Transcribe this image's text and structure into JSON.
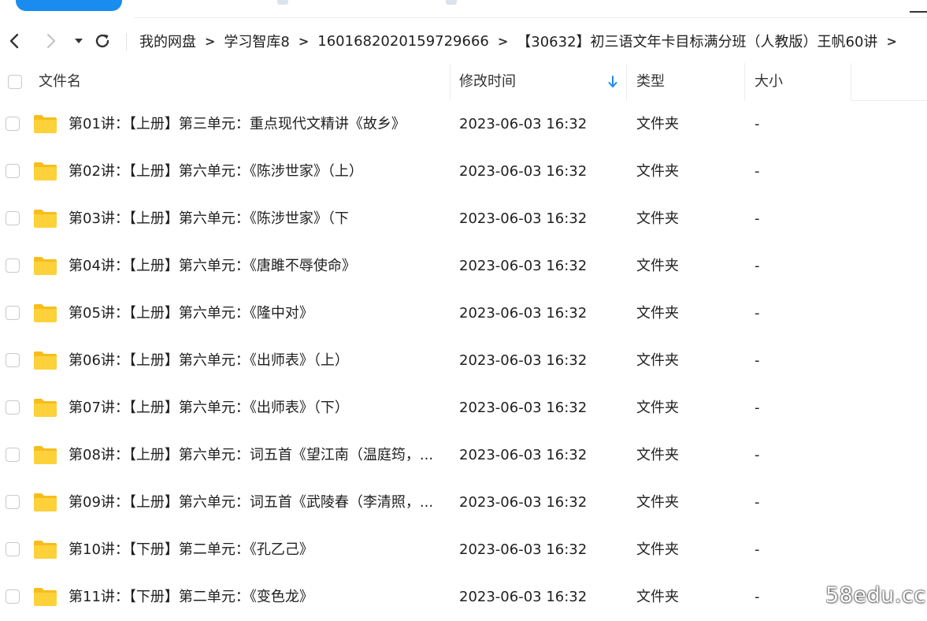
{
  "nav": {
    "back_icon": "arrow-left-icon",
    "forward_icon": "arrow-right-icon",
    "history_icon": "caret-down-icon",
    "refresh_icon": "refresh-icon",
    "separator": ">",
    "breadcrumbs": [
      "我的网盘",
      "学习智库8",
      "1601682020159729666",
      "【30632】初三语文年卡目标满分班（人教版）王帆60讲"
    ]
  },
  "columns": {
    "name": "文件名",
    "modified": "修改时间",
    "type": "类型",
    "size": "大小"
  },
  "colors": {
    "accent": "#1a8cf0",
    "folder": "#fdd13a",
    "folder_dark": "#f7bd1c"
  },
  "files": [
    {
      "name": "第01讲：【上册】第三单元：重点现代文精讲《故乡》",
      "modified": "2023-06-03 16:32",
      "type": "文件夹",
      "size": "-"
    },
    {
      "name": "第02讲：【上册】第六单元：《陈涉世家》（上）",
      "modified": "2023-06-03 16:32",
      "type": "文件夹",
      "size": "-"
    },
    {
      "name": "第03讲：【上册】第六单元：《陈涉世家》（下",
      "modified": "2023-06-03 16:32",
      "type": "文件夹",
      "size": "-"
    },
    {
      "name": "第04讲：【上册】第六单元：《唐雎不辱使命》",
      "modified": "2023-06-03 16:32",
      "type": "文件夹",
      "size": "-"
    },
    {
      "name": "第05讲：【上册】第六单元：《隆中对》",
      "modified": "2023-06-03 16:32",
      "type": "文件夹",
      "size": "-"
    },
    {
      "name": "第06讲：【上册】第六单元：《出师表》（上）",
      "modified": "2023-06-03 16:32",
      "type": "文件夹",
      "size": "-"
    },
    {
      "name": "第07讲：【上册】第六单元：《出师表》（下）",
      "modified": "2023-06-03 16:32",
      "type": "文件夹",
      "size": "-"
    },
    {
      "name": "第08讲：【上册】第六单元：词五首《望江南（温庭筠，...",
      "modified": "2023-06-03 16:32",
      "type": "文件夹",
      "size": "-"
    },
    {
      "name": "第09讲：【上册】第六单元：词五首《武陵春（李清照，...",
      "modified": "2023-06-03 16:32",
      "type": "文件夹",
      "size": "-"
    },
    {
      "name": "第10讲：【下册】第二单元：《孔乙己》",
      "modified": "2023-06-03 16:32",
      "type": "文件夹",
      "size": "-"
    },
    {
      "name": "第11讲：【下册】第二单元：《变色龙》",
      "modified": "2023-06-03 16:32",
      "type": "文件夹",
      "size": "-"
    }
  ],
  "watermark": "58edu.cc"
}
